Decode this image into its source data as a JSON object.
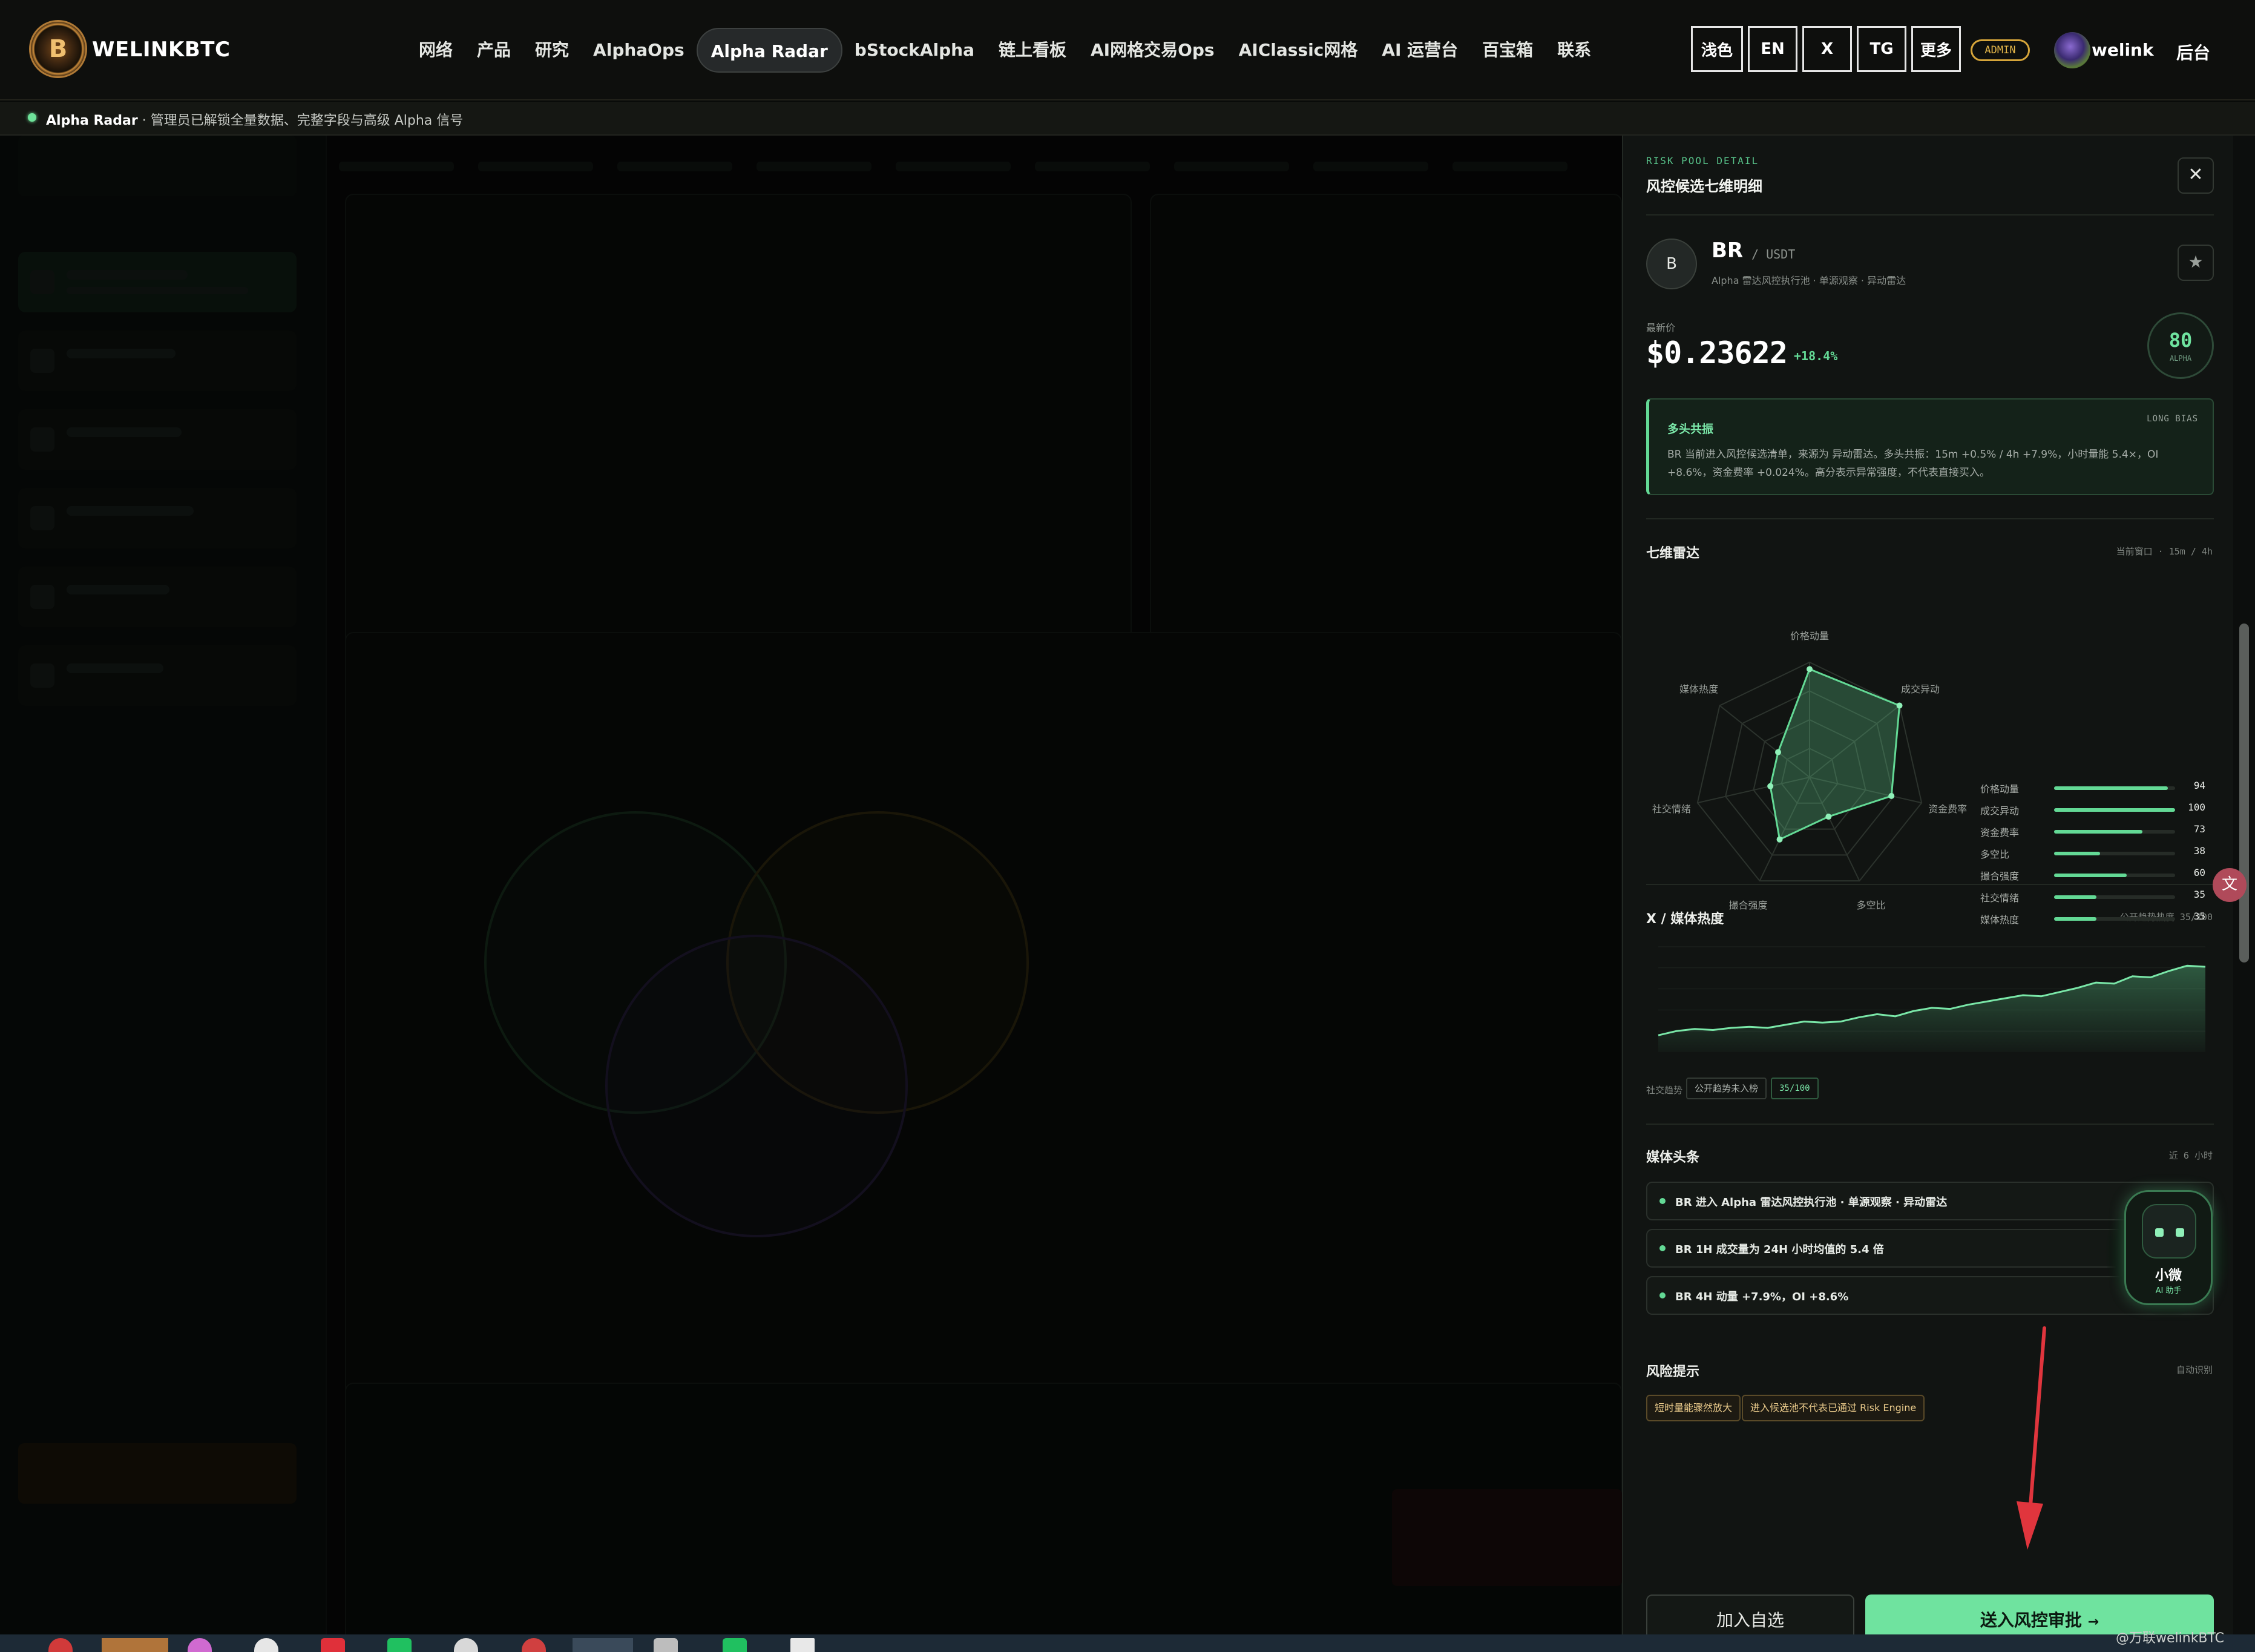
{
  "brand": {
    "name": "WELINKBTC",
    "logo_glyph": "B"
  },
  "nav": {
    "links": [
      "网络",
      "产品",
      "研究",
      "AlphaOps",
      "Alpha Radar",
      "bStockAlpha",
      "链上看板",
      "AI网格交易Ops",
      "AIClassic网格",
      "AI 运营台",
      "百宝箱",
      "联系"
    ],
    "active": "Alpha Radar",
    "theme_btn": "浅色",
    "lang_btn": "EN",
    "x_btn": "X",
    "tg_btn": "TG",
    "more_btn": "更多",
    "admin_badge": "ADMIN",
    "username": "welink",
    "backend_link": "后台"
  },
  "subbar": {
    "title": "Alpha Radar",
    "text": " · 管理员已解锁全量数据、完整字段与高级 Alpha 信号"
  },
  "drawer": {
    "eyebrow": "RISK POOL DETAIL",
    "title": "风控候选七维明细",
    "close_icon": "close-icon",
    "coin": {
      "avatar_letter": "B",
      "symbol": "BR",
      "quote": "/ USDT",
      "tags": "Alpha 雷达风控执行池 · 单源观察 · 异动雷达",
      "star_icon": "star-icon"
    },
    "price": {
      "label": "最新价",
      "value": "$0.23622",
      "change": "+18.4%"
    },
    "alpha_score": {
      "value": "80",
      "label": "ALPHA"
    },
    "signal": {
      "title": "多头共振",
      "bias": "LONG BIAS",
      "text": "BR 当前进入风控候选清单，来源为 异动雷达。多头共振：15m +0.5% / 4h +7.9%，小时量能 5.4×，OI +8.6%，资金费率 +0.024%。高分表示异常强度，不代表直接买入。"
    },
    "radar": {
      "title": "七维雷达",
      "meta": "当前窗口 · 15m / 4h",
      "axes": [
        {
          "name": "价格动量",
          "value": 94
        },
        {
          "name": "成交异动",
          "value": 100
        },
        {
          "name": "资金费率",
          "value": 73
        },
        {
          "name": "多空比",
          "value": 38
        },
        {
          "name": "撮合强度",
          "value": 60
        },
        {
          "name": "社交情绪",
          "value": 35
        },
        {
          "name": "媒体热度",
          "value": 35
        }
      ]
    },
    "media_heat": {
      "title": "X / 媒体热度",
      "meta": "公开趋势热度 35/100",
      "chart_data": {
        "type": "area",
        "title": "",
        "values": [
          16,
          20,
          22,
          21,
          23,
          24,
          23,
          26,
          29,
          28,
          29,
          33,
          36,
          34,
          39,
          42,
          41,
          45,
          48,
          51,
          54,
          53,
          57,
          61,
          66,
          65,
          72,
          71,
          77,
          82,
          81
        ],
        "ylim": [
          0,
          100
        ],
        "grid": true
      },
      "footer_label": "社交趋势",
      "footer_tag": "公开趋势未入榜",
      "footer_score": "35/100"
    },
    "headlines": {
      "title": "媒体头条",
      "meta": "近 6 小时",
      "items": [
        "BR 进入 Alpha 雷达风控执行池 · 单源观察 · 异动雷达",
        "BR 1H 成交量为 24H 小时均值的 5.4 倍",
        "BR 4H 动量 +7.9%，OI +8.6%"
      ]
    },
    "risk": {
      "title": "风险提示",
      "meta": "自动识别",
      "tags": [
        "短时量能骤然放大",
        "进入候选池不代表已通过 Risk Engine"
      ]
    },
    "actions": {
      "watch": "加入自选",
      "submit": "送入风控审批",
      "submit_arrow": "→"
    }
  },
  "assistant": {
    "name": "小微",
    "sub": "AI 助手"
  },
  "watermark": "@万联welinkBTC"
}
